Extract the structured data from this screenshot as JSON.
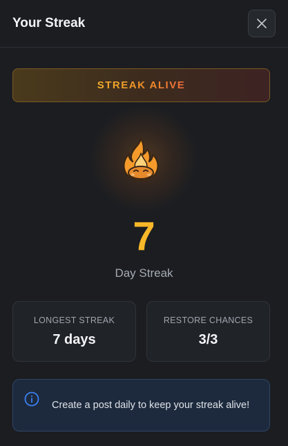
{
  "header": {
    "title": "Your Streak"
  },
  "status": {
    "text": "STREAK ALIVE"
  },
  "streak": {
    "count": "7",
    "label": "Day Streak"
  },
  "stats": [
    {
      "label": "LONGEST STREAK",
      "value": "7 days"
    },
    {
      "label": "RESTORE CHANCES",
      "value": "3/3"
    }
  ],
  "info": {
    "text": "Create a post daily to keep your streak alive!"
  },
  "icons": {
    "close": "close-icon",
    "flame": "flame-icon",
    "info": "info-icon"
  },
  "colors": {
    "background": "#1b1d21",
    "accent": "#f7b729",
    "banner_text_start": "#f3b02a",
    "banner_text_end": "#ec6b3b",
    "info_bg": "#1d2a3d",
    "info_icon": "#3b82f6"
  }
}
